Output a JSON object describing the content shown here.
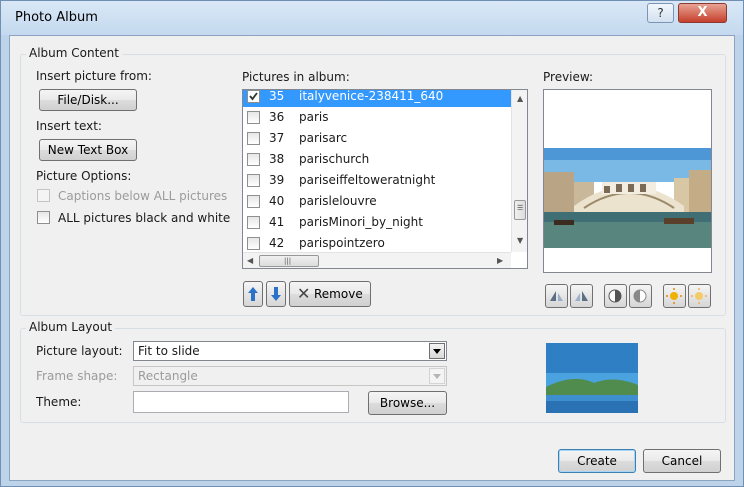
{
  "window": {
    "title": "Photo Album",
    "help_label": "?",
    "close_label": "X"
  },
  "album_content": {
    "group_label": "Album Content",
    "insert_picture_from": "Insert picture from:",
    "file_disk_button": "File/Disk...",
    "insert_text": "Insert text:",
    "new_text_box_button": "New Text Box",
    "picture_options": "Picture Options:",
    "captions_below": "Captions below ALL pictures",
    "captions_below_checked": false,
    "black_and_white": "ALL pictures black and white",
    "black_and_white_checked": false,
    "pictures_in_album_label": "Pictures in album:",
    "pictures": [
      {
        "num": "35",
        "name": "italyvenice-238411_640",
        "checked": true,
        "selected": true
      },
      {
        "num": "36",
        "name": "paris",
        "checked": false,
        "selected": false
      },
      {
        "num": "37",
        "name": "parisarc",
        "checked": false,
        "selected": false
      },
      {
        "num": "38",
        "name": "parischurch",
        "checked": false,
        "selected": false
      },
      {
        "num": "39",
        "name": "pariseiffeltoweratnight",
        "checked": false,
        "selected": false
      },
      {
        "num": "40",
        "name": "parislelouvre",
        "checked": false,
        "selected": false
      },
      {
        "num": "41",
        "name": "parisMinori_by_night",
        "checked": false,
        "selected": false
      },
      {
        "num": "42",
        "name": "parispointzero",
        "checked": false,
        "selected": false
      }
    ],
    "move_up_icon": "arrow-up-icon",
    "move_down_icon": "arrow-down-icon",
    "remove_button": "Remove",
    "preview_label": "Preview:",
    "preview_tools": [
      "rotate-left-icon",
      "rotate-right-icon",
      "contrast-up-icon",
      "contrast-down-icon",
      "brightness-up-icon",
      "brightness-down-icon"
    ]
  },
  "album_layout": {
    "group_label": "Album Layout",
    "picture_layout_label": "Picture layout:",
    "picture_layout_value": "Fit to slide",
    "frame_shape_label": "Frame shape:",
    "frame_shape_value": "Rectangle",
    "theme_label": "Theme:",
    "theme_value": "",
    "browse_button": "Browse..."
  },
  "footer": {
    "create_button": "Create",
    "cancel_button": "Cancel"
  },
  "colors": {
    "selection": "#3399ff",
    "arrow_blue": "#2a72c8"
  }
}
